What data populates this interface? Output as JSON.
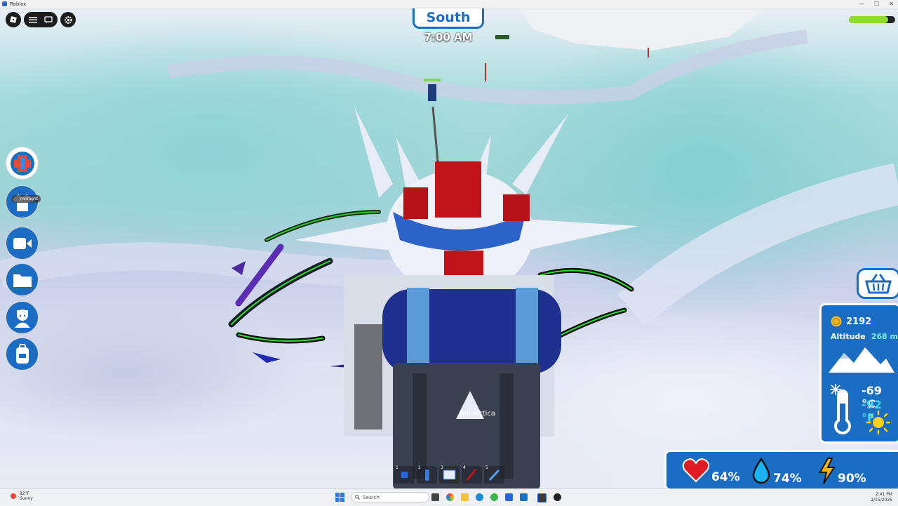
{
  "window": {
    "title": "Roblox",
    "minimize": "—",
    "maximize": "☐",
    "close": "✕"
  },
  "hud": {
    "heading": "South",
    "time": "7:00 AM",
    "energy_fraction": 0.85,
    "coins": "2192",
    "altitude_label": "Altitude",
    "altitude_value": "268 m",
    "temp_c": "-69 °C",
    "temp_f": "-92 °F",
    "health": "64%",
    "thirst": "74%",
    "stamina": "90%",
    "player_tag": "mnnight"
  },
  "hotbar": {
    "slots": [
      "1",
      "2",
      "3",
      "4",
      "5"
    ]
  },
  "backpack": {
    "brand": "Antarctica"
  },
  "taskbar": {
    "weather_temp": "82°F",
    "weather_desc": "Sunny",
    "search_placeholder": "Search",
    "time": "2:41 PM",
    "date": "2/15/2026"
  },
  "colors": {
    "accent_blue": "#1a6dc2",
    "energy_green": "#8fdc30",
    "heart_red": "#e01b24",
    "water_blue": "#1ab3f0",
    "bolt_yellow": "#f5b50a"
  }
}
